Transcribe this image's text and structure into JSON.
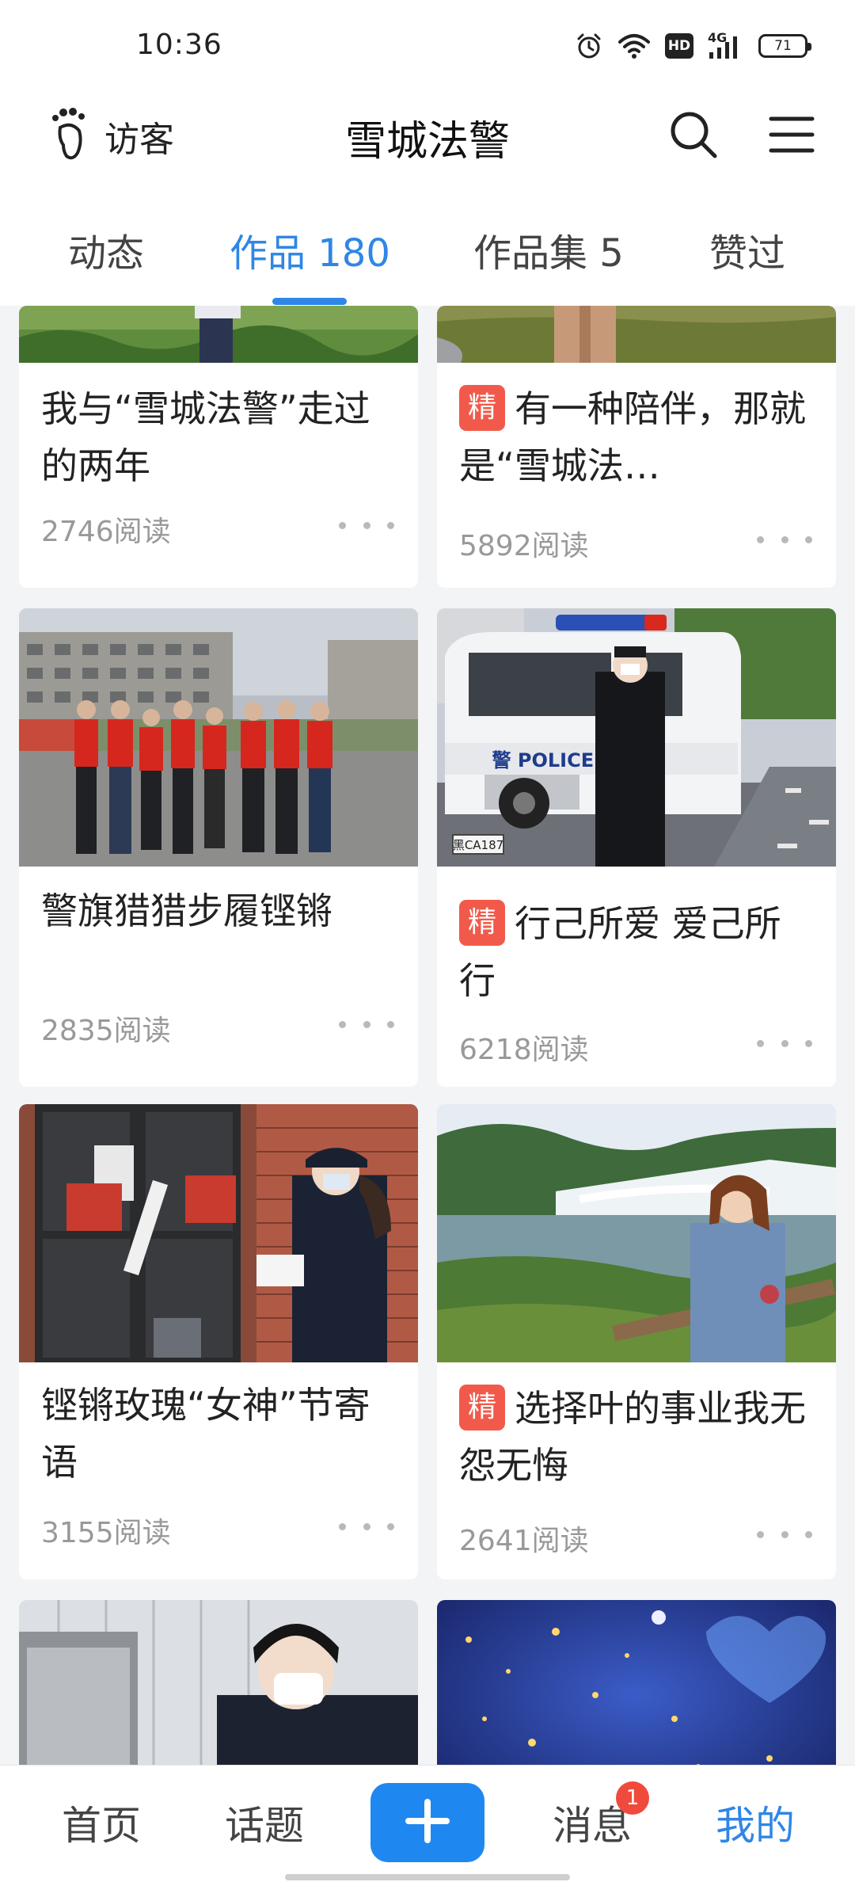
{
  "status_bar": {
    "time": "10:36",
    "network": "4G",
    "hd_label": "HD",
    "battery": "71",
    "icons": [
      "alarm-icon",
      "wifi-icon",
      "hd-icon",
      "signal-icon",
      "battery-icon"
    ]
  },
  "header": {
    "visitor_label": "访客",
    "title": "雪城法警",
    "icons": [
      "footprint-icon",
      "search-icon",
      "menu-icon"
    ]
  },
  "tabs": [
    {
      "label": "动态",
      "active": false
    },
    {
      "label": "作品 180",
      "active": true
    },
    {
      "label": "作品集 5",
      "active": false
    },
    {
      "label": "赞过",
      "active": false
    }
  ],
  "cards": [
    {
      "badge": "",
      "title": "我与“雪城法警”走过的两年",
      "reads": "2746阅读"
    },
    {
      "badge": "精",
      "title": "有一种陪伴，那就是“雪城法…",
      "reads": "5892阅读"
    },
    {
      "badge": "",
      "title": "警旗猎猎步履铿锵",
      "reads": "2835阅读"
    },
    {
      "badge": "精",
      "title": "行己所爱 爱己所行",
      "reads": "6218阅读"
    },
    {
      "badge": "",
      "title": "铿锵玫瑰“女神”节寄语",
      "reads": "3155阅读"
    },
    {
      "badge": "精",
      "title": "选择叶的事业我无怨无悔",
      "reads": "2641阅读"
    }
  ],
  "image_text": {
    "police_van": "警 POLICE 察",
    "plate": "黑CA187"
  },
  "bottom_nav": {
    "items": [
      {
        "label": "首页",
        "active": false
      },
      {
        "label": "话题",
        "active": false
      },
      {
        "label": "消息",
        "active": false
      },
      {
        "label": "我的",
        "active": true
      }
    ],
    "message_badge": "1"
  },
  "colors": {
    "accent": "#2f86e6",
    "badge_red": "#f15a4a",
    "plus_button": "#1e88f0"
  }
}
